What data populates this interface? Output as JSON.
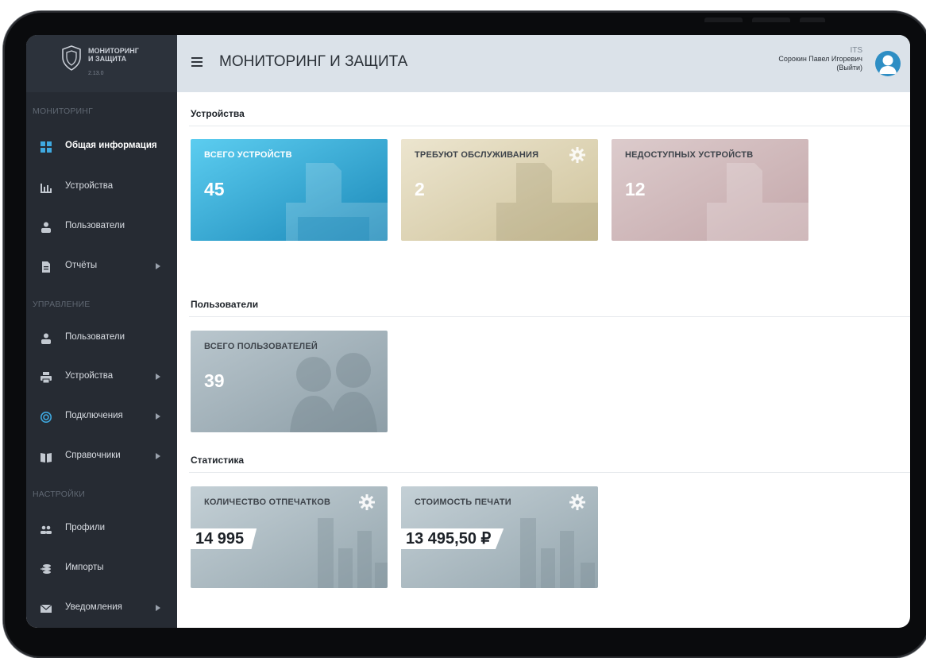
{
  "app": {
    "logo_line1": "МОНИТОРИНГ",
    "logo_line2": "И ЗАЩИТА",
    "version": "2.13.0",
    "title": "МОНИТОРИНГ И ЗАЩИТА"
  },
  "user": {
    "org": "ITS",
    "name": "Сорокин Павел Игоревич",
    "logout": "(Выйти)"
  },
  "sidebar": {
    "sections": [
      {
        "title": "МОНИТОРИНГ",
        "items": [
          {
            "label": "Общая информация",
            "icon": "dashboard-icon",
            "active": true
          },
          {
            "label": "Устройства",
            "icon": "bar-chart-icon"
          },
          {
            "label": "Пользователи",
            "icon": "users-icon"
          },
          {
            "label": "Отчёты",
            "icon": "report-icon",
            "submenu": true
          }
        ]
      },
      {
        "title": "УПРАВЛЕНИЕ",
        "items": [
          {
            "label": "Пользователи",
            "icon": "users-icon"
          },
          {
            "label": "Устройства",
            "icon": "printer-icon",
            "submenu": true
          },
          {
            "label": "Подключения",
            "icon": "connection-icon",
            "submenu": true
          },
          {
            "label": "Справочники",
            "icon": "book-icon",
            "submenu": true
          }
        ]
      },
      {
        "title": "НАСТРОЙКИ",
        "items": [
          {
            "label": "Профили",
            "icon": "profiles-icon"
          },
          {
            "label": "Импорты",
            "icon": "import-icon"
          },
          {
            "label": "Уведомления",
            "icon": "mail-icon",
            "submenu": true
          }
        ]
      }
    ]
  },
  "groups": {
    "devices": {
      "title": "Устройства",
      "cards": [
        {
          "label": "ВСЕГО УСТРОЙСТВ",
          "value": "45"
        },
        {
          "label": "ТРЕБУЮТ ОБСЛУЖИВАНИЯ",
          "value": "2"
        },
        {
          "label": "НЕДОСТУПНЫХ УСТРОЙСТВ",
          "value": "12"
        }
      ]
    },
    "users": {
      "title": "Пользователи",
      "cards": [
        {
          "label": "ВСЕГО ПОЛЬЗОВАТЕЛЕЙ",
          "value": "39"
        }
      ]
    },
    "stats": {
      "title": "Статистика",
      "cards": [
        {
          "label": "КОЛИЧЕСТВО ОТПЕЧАТКОВ",
          "value": "14 995"
        },
        {
          "label": "СТОИМОСТЬ ПЕЧАТИ",
          "value": "13 495,50 ₽"
        }
      ]
    }
  },
  "colors": {
    "sidebar": "#262b33",
    "topbar": "#dbe2e9",
    "card_blue": "#2f9bc9",
    "card_beige": "#d9cfb0",
    "card_rose": "#cfb6b8",
    "card_gray": "#a3b1b9"
  }
}
